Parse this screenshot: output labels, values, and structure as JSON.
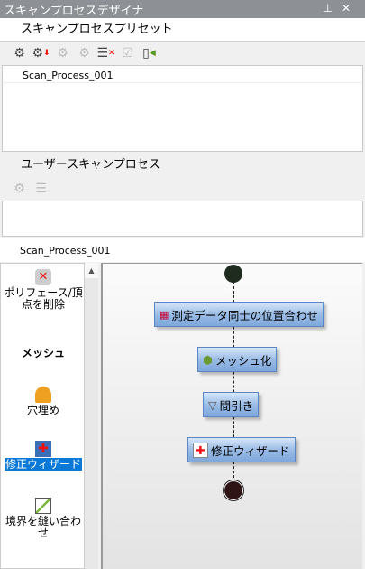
{
  "window": {
    "title": "スキャンプロセスデザイナ",
    "pin": "⊥",
    "close": "✕"
  },
  "presets": {
    "header": "スキャンプロセスプリセット",
    "items": [
      "Scan_Process_001"
    ]
  },
  "user": {
    "header": "ユーザースキャンプロセス",
    "current": "Scan_Process_001"
  },
  "palette": {
    "items": [
      {
        "label": "ポリフェース/頂点を削除",
        "icon": "delete-polyface-icon"
      },
      {
        "label": "メッシュ",
        "category": true
      },
      {
        "label": "穴埋め",
        "icon": "fill-holes-icon"
      },
      {
        "label": "修正ウィザード",
        "icon": "repair-wizard-icon",
        "selected": true
      },
      {
        "label": "境界を縫い合わせ",
        "icon": "stitch-boundary-icon"
      }
    ]
  },
  "flow": {
    "nodes": [
      "測定データ同士の位置合わせ",
      "メッシュ化",
      "間引き",
      "修正ウィザード"
    ]
  }
}
